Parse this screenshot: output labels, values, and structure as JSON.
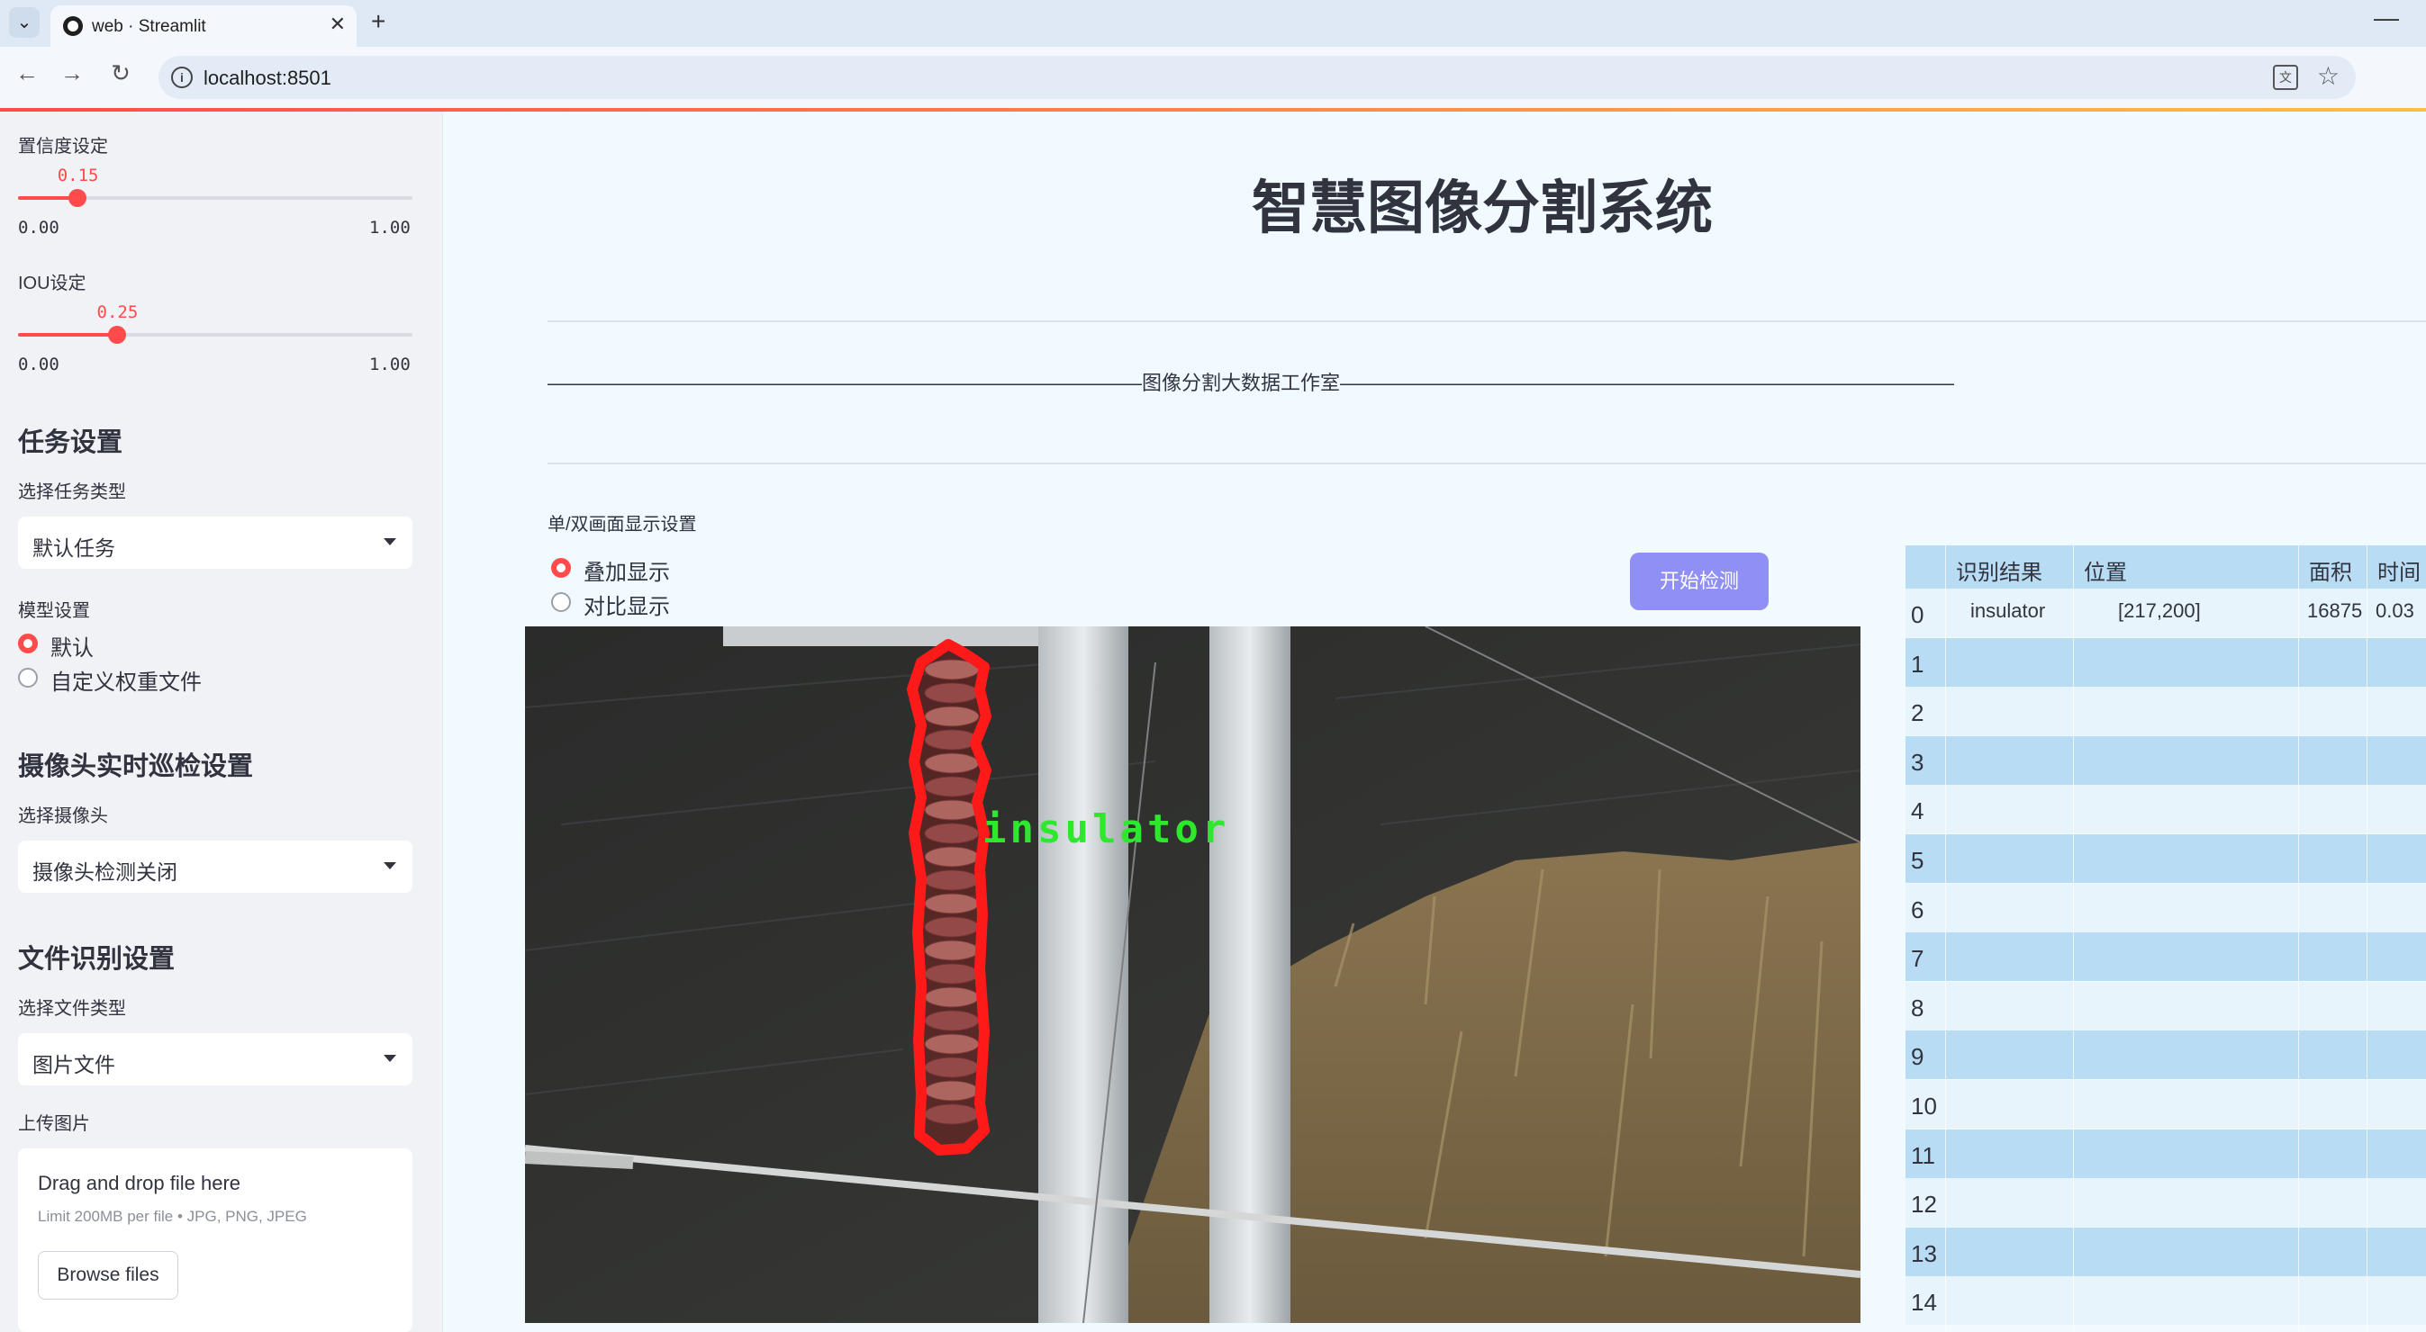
{
  "browser": {
    "tab_title": "web · Streamlit",
    "url": "localhost:8501"
  },
  "sidebar": {
    "confidence": {
      "label": "置信度设定",
      "value": "0.15",
      "value_num": 0.15,
      "min": "0.00",
      "max": "1.00"
    },
    "iou": {
      "label": "IOU设定",
      "value": "0.25",
      "value_num": 0.25,
      "min": "0.00",
      "max": "1.00"
    },
    "task_heading": "任务设置",
    "task_type_label": "选择任务类型",
    "task_type_value": "默认任务",
    "model_label": "模型设置",
    "model_options": [
      "默认",
      "自定义权重文件"
    ],
    "camera_heading": "摄像头实时巡检设置",
    "camera_label": "选择摄像头",
    "camera_value": "摄像头检测关闭",
    "file_heading": "文件识别设置",
    "file_type_label": "选择文件类型",
    "file_type_value": "图片文件",
    "upload_label": "上传图片",
    "upload_main": "Drag and drop file here",
    "upload_sub": "Limit 200MB per file • JPG, PNG, JPEG",
    "browse_label": "Browse files"
  },
  "main": {
    "title": "智慧图像分割系统",
    "divider_text": "——————————————————————————————图像分割大数据工作室———————————————————————————————",
    "display_mode_label": "单/双画面显示设置",
    "display_options": [
      "叠加显示",
      "对比显示"
    ],
    "start_button": "开始检测",
    "detection_label": "insulator"
  },
  "table": {
    "columns": [
      "识别结果",
      "位置",
      "面积",
      "时间"
    ],
    "rows": [
      {
        "idx": "0",
        "result": "insulator",
        "position": "[217,200]",
        "area": "16875",
        "time": "0.03"
      },
      {
        "idx": "1"
      },
      {
        "idx": "2"
      },
      {
        "idx": "3"
      },
      {
        "idx": "4"
      },
      {
        "idx": "5"
      },
      {
        "idx": "6"
      },
      {
        "idx": "7"
      },
      {
        "idx": "8"
      },
      {
        "idx": "9"
      },
      {
        "idx": "10"
      },
      {
        "idx": "11"
      },
      {
        "idx": "12"
      },
      {
        "idx": "13"
      },
      {
        "idx": "14"
      }
    ]
  },
  "colors": {
    "accent": "#ff4b4b",
    "button": "#8f8ff5",
    "table_stripe": "#b9dcf5",
    "detection": "#ff1a1a"
  }
}
